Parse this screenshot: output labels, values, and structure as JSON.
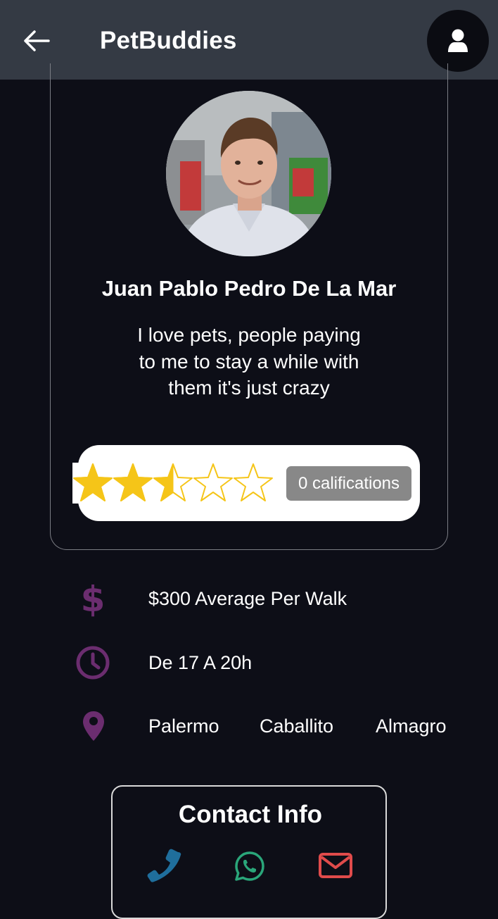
{
  "app": {
    "title": "PetBuddies"
  },
  "icons": {
    "back": "arrow-left-icon",
    "user": "user-icon",
    "price": "dollar-icon",
    "schedule": "clock-icon",
    "location": "map-pin-icon",
    "phone": "phone-icon",
    "whatsapp": "whatsapp-icon",
    "email": "envelope-icon"
  },
  "profile": {
    "name": "Juan Pablo Pedro De La Mar",
    "bio": "I love pets, people paying to me to stay a while with them it's just crazy",
    "rating": 2.5,
    "rating_max": 5,
    "ratings_label": "0 califications"
  },
  "details": {
    "price": "$300 Average Per Walk",
    "schedule": "De 17 A 20h",
    "zones": [
      "Palermo",
      "Caballito",
      "Almagro"
    ]
  },
  "contact": {
    "title": "Contact Info"
  },
  "colors": {
    "background": "#0d0e17",
    "appbar": "#343a44",
    "accent_purple": "#6b2d6f",
    "star": "#f5c518",
    "phone": "#1f6e9c",
    "whatsapp": "#2aa67a",
    "email": "#e04b4b"
  }
}
